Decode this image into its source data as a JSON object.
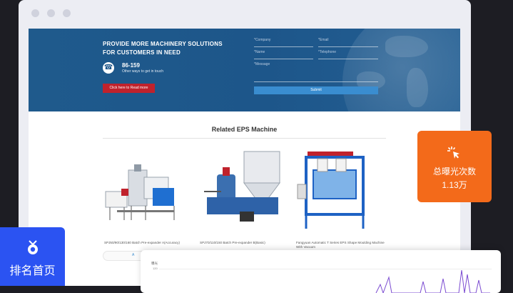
{
  "hero": {
    "title": "PROVIDE MORE MACHINERY SOLUTIONS FOR CUSTOMERS IN NEED",
    "phone": "86-159",
    "phone_sub": "Other ways to get in touch",
    "read_more": "Click here to Read more"
  },
  "form": {
    "company": "*Company",
    "email": "*Email",
    "name": "*Name",
    "telephone": "*Telephone",
    "message": "*Message",
    "submit": "Submit"
  },
  "section": {
    "title": "Related EPS Machine"
  },
  "products": [
    {
      "caption": "SPJ50/90/130/160 Batch Pre-expander A(Accuracy)"
    },
    {
      "caption": "SPJ70/110/150 Batch Pre-expander B(Basic)"
    },
    {
      "caption": "Fangyuan Automatic T Series EPS Shape Moulding Machine With Vacuum"
    }
  ],
  "strip_label": "A",
  "exposure": {
    "label": "总曝光次数",
    "value": "1.13万"
  },
  "ranking": {
    "label": "排名首页"
  },
  "chart": {
    "ylabel": "曝光",
    "ytick": "120"
  },
  "colors": {
    "brand": "#1d568a",
    "accent_red": "#c0222c",
    "orange": "#f36a1a",
    "blue": "#2b53f2"
  }
}
